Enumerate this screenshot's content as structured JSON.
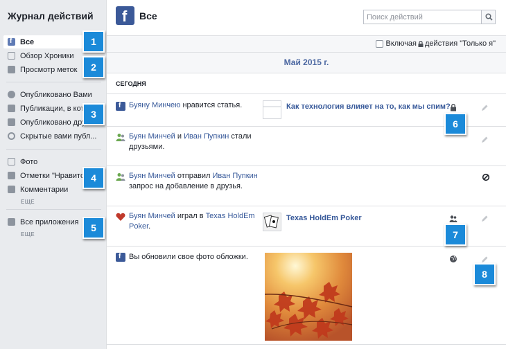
{
  "sidebar": {
    "title": "Журнал действий",
    "items": [
      {
        "label": "Все",
        "icon": "facebook-icon"
      },
      {
        "label": "Обзор Хроники",
        "icon": "timeline-icon"
      },
      {
        "label": "Просмотр меток",
        "icon": "tag-icon"
      },
      {
        "label": "Опубликовано Вами",
        "icon": "person-icon"
      },
      {
        "label": "Публикации, в кот",
        "icon": "tag-icon"
      },
      {
        "label": "Опубликовано дру",
        "icon": "friends-post-icon"
      },
      {
        "label": "Скрытые вами публ...",
        "icon": "hidden-icon"
      },
      {
        "label": "Фото",
        "icon": "photo-icon"
      },
      {
        "label": "Отметки \"Нравится\"",
        "icon": "like-icon"
      },
      {
        "label": "Комментарии",
        "icon": "comment-icon"
      },
      {
        "label": "Все приложения",
        "icon": "apps-icon"
      }
    ],
    "more_label_1": "ЕЩЕ",
    "more_label_2": "ЕЩЕ"
  },
  "badges": [
    "1",
    "2",
    "3",
    "4",
    "5",
    "6",
    "7",
    "8"
  ],
  "header": {
    "title": "Все",
    "search_placeholder": "Поиск действий"
  },
  "filter": {
    "prefix": "Включая",
    "suffix": "действия \"Только я\""
  },
  "timeline": {
    "month": "Май 2015 г.",
    "today": "СЕГОДНЯ",
    "rows": [
      {
        "actor": "Буяну Минчею",
        "text": " нравится статья.",
        "link": "Как технология влияет на то, как мы спим?",
        "privacy": "lock-icon"
      },
      {
        "actor": "Буян Минчей",
        "and": " и ",
        "actor2": "Иван Пупкин",
        "text": " стали друзьями.",
        "privacy": "none"
      },
      {
        "actor": "Буян Минчей",
        "text": " отправил ",
        "actor2": "Иван Пупкин",
        "text2": " запрос на добавление в друзья.",
        "privacy": "blocked-icon"
      },
      {
        "actor": "Буян Минчей",
        "text": " играл в ",
        "game": "Texas HoldEm Poker",
        "text2": ".",
        "link": "Texas HoldEm Poker",
        "privacy": "friends-icon"
      },
      {
        "text": "Вы обновили свое фото обложки.",
        "privacy": "globe-icon"
      }
    ]
  },
  "colors": {
    "accent": "#1b8ad9",
    "facebook_blue": "#3b5998",
    "link": "#365899"
  }
}
